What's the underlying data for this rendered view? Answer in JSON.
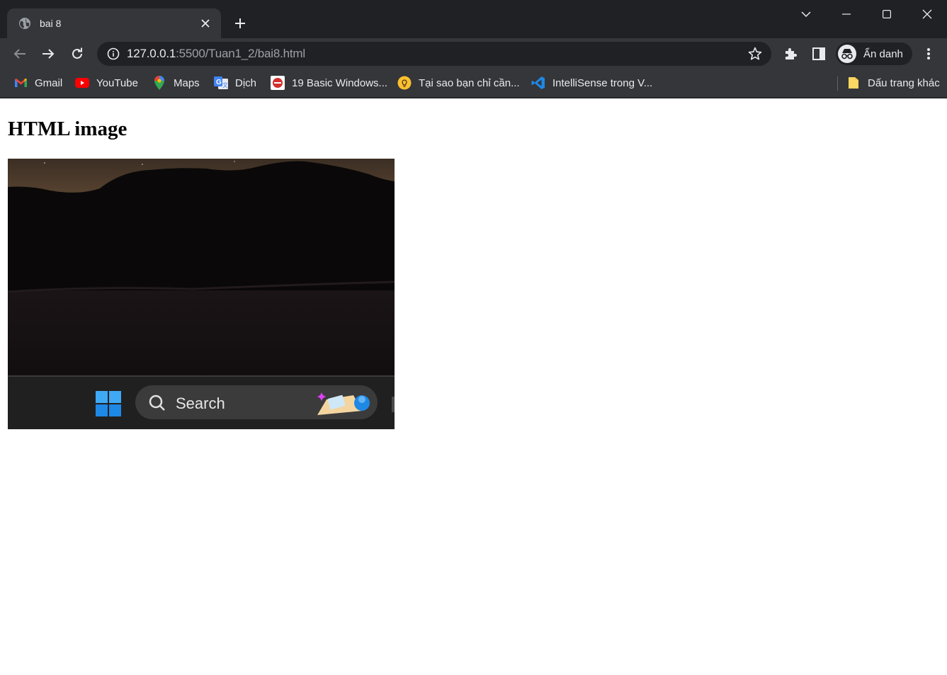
{
  "tab": {
    "title": "bai 8"
  },
  "omnibox": {
    "url_host": "127.0.0.1",
    "url_path": ":5500/Tuan1_2/bai8.html"
  },
  "profile": {
    "label": "Ẩn danh"
  },
  "bookmarks": {
    "items": [
      {
        "label": "Gmail",
        "icon": "gmail-icon"
      },
      {
        "label": "YouTube",
        "icon": "youtube-icon"
      },
      {
        "label": "Maps",
        "icon": "maps-icon"
      },
      {
        "label": "Dịch",
        "icon": "translate-icon"
      },
      {
        "label": "19 Basic Windows...",
        "icon": "site-icon"
      },
      {
        "label": "Tại sao bạn chỉ cần...",
        "icon": "lightbulb-icon"
      },
      {
        "label": "IntelliSense trong V...",
        "icon": "vscode-icon"
      }
    ],
    "other": {
      "label": "Dấu trang khác",
      "icon": "folder-icon"
    }
  },
  "page": {
    "heading": "HTML image",
    "image": {
      "taskbar_search_label": "Search"
    }
  },
  "colors": {
    "titlebar": "#202124",
    "toolbar": "#35363a",
    "text": "#e8eaed",
    "url_dim": "#9aa0a6",
    "page_bg": "#ffffff"
  }
}
